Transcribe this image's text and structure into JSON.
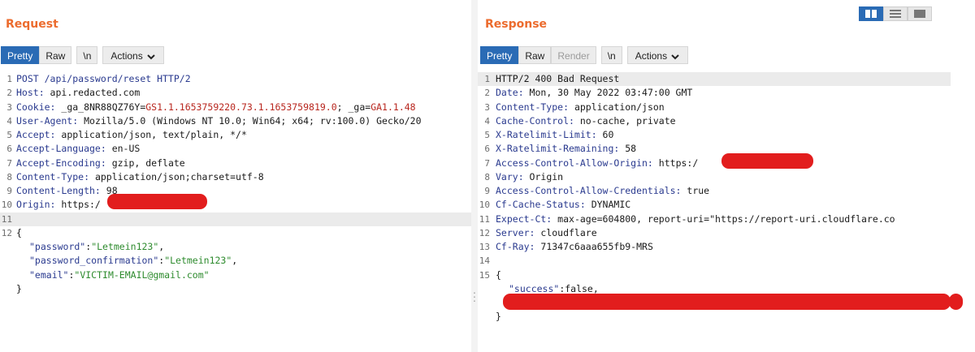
{
  "request": {
    "title": "Request",
    "tabs": {
      "pretty": "Pretty",
      "raw": "Raw",
      "newline": "\\n",
      "actions": "Actions"
    },
    "lines": [
      {
        "n": "1",
        "k": "POST /api/password/reset HTTP/2",
        "v": ""
      },
      {
        "n": "2",
        "k": "Host:",
        "v": " api.redacted.com"
      },
      {
        "n": "3",
        "k": "Cookie:",
        "v": " _ga_8NR88QZ76Y=GS1.1.1653759220.73.1.1653759819.0; _ga=GA1.1.48"
      },
      {
        "n": "4",
        "k": "User-Agent:",
        "v": " Mozilla/5.0 (Windows NT 10.0; Win64; x64; rv:100.0) Gecko/20"
      },
      {
        "n": "5",
        "k": "Accept:",
        "v": " application/json, text/plain, */*"
      },
      {
        "n": "6",
        "k": "Accept-Language:",
        "v": " en-US"
      },
      {
        "n": "7",
        "k": "Accept-Encoding:",
        "v": " gzip, deflate"
      },
      {
        "n": "8",
        "k": "Content-Type:",
        "v": " application/json;charset=utf-8"
      },
      {
        "n": "9",
        "k": "Content-Length:",
        "v": " 98"
      },
      {
        "n": "10",
        "k": "Origin:",
        "v": " https:/"
      },
      {
        "n": "11",
        "k": "",
        "v": ""
      },
      {
        "n": "12",
        "k": "{",
        "v": ""
      }
    ],
    "cookie": {
      "ga_id_name": " _ga_8NR88QZ76Y=",
      "ga_id_value": "GS1.1.1653759220.73.1.1653759819.0",
      "ga_name": "; _ga=",
      "ga_value": "GA1.1.48"
    },
    "body": [
      {
        "key": "\"password\"",
        "sep": ":",
        "val": "\"Letmein123\"",
        "end": ","
      },
      {
        "key": "\"password_confirmation\"",
        "sep": ":",
        "val": "\"Letmein123\"",
        "end": ","
      },
      {
        "key": "\"email\"",
        "sep": ":",
        "val": "\"VICTIM-EMAIL@gmail.com\"",
        "end": ""
      }
    ],
    "close_brace": "}"
  },
  "response": {
    "title": "Response",
    "tabs": {
      "pretty": "Pretty",
      "raw": "Raw",
      "render": "Render",
      "newline": "\\n",
      "actions": "Actions"
    },
    "lines": [
      {
        "n": "1",
        "k": "HTTP/2 400 Bad Request",
        "v": ""
      },
      {
        "n": "2",
        "k": "Date:",
        "v": " Mon, 30 May 2022 03:47:00 GMT"
      },
      {
        "n": "3",
        "k": "Content-Type:",
        "v": " application/json"
      },
      {
        "n": "4",
        "k": "Cache-Control:",
        "v": " no-cache, private"
      },
      {
        "n": "5",
        "k": "X-Ratelimit-Limit:",
        "v": " 60"
      },
      {
        "n": "6",
        "k": "X-Ratelimit-Remaining:",
        "v": " 58"
      },
      {
        "n": "7",
        "k": "Access-Control-Allow-Origin:",
        "v": " https:/"
      },
      {
        "n": "8",
        "k": "Vary:",
        "v": " Origin"
      },
      {
        "n": "9",
        "k": "Access-Control-Allow-Credentials:",
        "v": " true"
      },
      {
        "n": "10",
        "k": "Cf-Cache-Status:",
        "v": " DYNAMIC"
      },
      {
        "n": "11",
        "k": "Expect-Ct:",
        "v": " max-age=604800, report-uri=\"https://report-uri.cloudflare.co"
      },
      {
        "n": "12",
        "k": "Server:",
        "v": " cloudflare"
      },
      {
        "n": "13",
        "k": "Cf-Ray:",
        "v": " 71347c6aaa655fb9-MRS"
      },
      {
        "n": "14",
        "k": "",
        "v": ""
      },
      {
        "n": "15",
        "k": "{",
        "v": ""
      }
    ],
    "body_key": "\"success\"",
    "body_sep": ":false,",
    "close_brace": "}"
  },
  "colors": {
    "accent": "#2a6bb5",
    "title": "#ec6b2d",
    "redaction": "#e21d1d",
    "json_string": "#2e8b2e",
    "cookie_value": "#b8261e"
  },
  "icons": [
    "chevron-down-icon",
    "layout-side-by-side-icon",
    "layout-stacked-icon",
    "layout-single-icon",
    "grip-icon"
  ]
}
